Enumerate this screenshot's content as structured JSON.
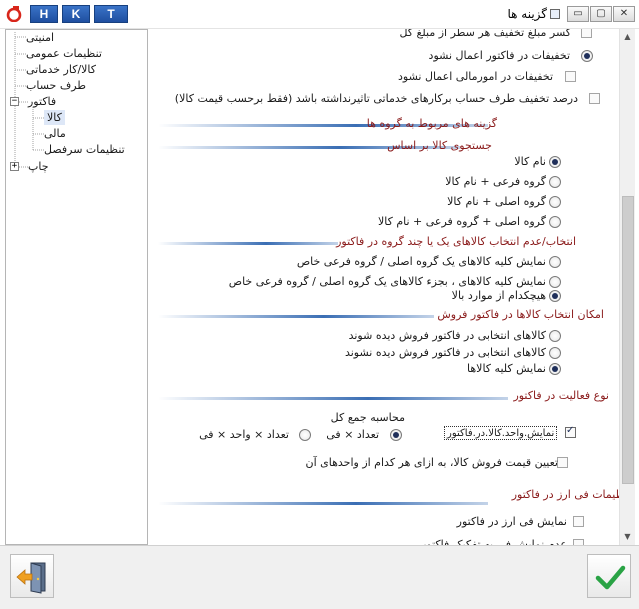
{
  "window": {
    "title": "گزینه ها",
    "lang_buttons": [
      "H",
      "K",
      "T"
    ],
    "controls": {
      "minimize": "▭",
      "maximize": "▢",
      "close": "✕"
    }
  },
  "tree": {
    "items": [
      {
        "label": "امنیتی"
      },
      {
        "label": "تنظیمات عمومی"
      },
      {
        "label": "کالا/کار خدماتی"
      },
      {
        "label": "طرف حساب"
      },
      {
        "label": "فاکتور",
        "expander": "−"
      },
      {
        "label": "کالا",
        "selected": true
      },
      {
        "label": "مالی"
      },
      {
        "label": "تنظیمات سرفصل"
      },
      {
        "label": "چاپ",
        "expander": "+"
      }
    ]
  },
  "settings": {
    "discount": {
      "cut_line_discount": "کسر مبلغ تخفیف هر سطر از مبلغ کل",
      "no_invoice_discount": "تخفیفات در فاکتور اعمال نشود",
      "no_finance_discount": "تخفیفات در امورمالی اعمال نشود",
      "party_discount_pct": "درصد تخفیف طرف حساب برکارهای خدماتی تاثیرنداشته باشد (فقط برحسب قیمت کالا)"
    },
    "group_options_header": "گزینه های مربوط به گروه ها",
    "search": {
      "header": "جستجوی کالا بر اساس",
      "options": [
        "نام کالا",
        "گروه فرعی + نام کالا",
        "گروه اصلی + نام کالا",
        "گروه اصلی + گروه فرعی + نام کالا"
      ]
    },
    "select_groups": {
      "header": "انتخاب/عدم انتخاب کالاهای یک یا چند گروه در فاکتور",
      "options": [
        "نمایش کلیه کالاهای یک گروه اصلی / گروه فرعی خاص",
        "نمایش کلیه کالاهای ، بجزء کالاهای یک گروه اصلی / گروه فرعی خاص",
        "هیچکدام از موارد بالا"
      ]
    },
    "sales_selection": {
      "header": "امکان انتخاب کالاها در فاکتور فروش",
      "options": [
        "کالاهای انتخابی در فاکتور فروش دیده شوند",
        "کالاهای انتخابی در فاکتور فروش دیده نشوند",
        "نمایش کلیه کالاها"
      ]
    },
    "activity": {
      "header": "نوع فعالیت در فاکتور",
      "calc_total_label": "محاسبه جمع کل",
      "show_unit_field": "نمایش.واحد.کالا.در.فاکتور",
      "opt_qty_price": "تعداد × فی",
      "opt_qty_unit_price": "تعداد × واحد × فی",
      "unit_price_each": "تعیین قیمت فروش کالا، به ازای هر کدام از واحدهای آن"
    },
    "currency": {
      "header": "تنظیمات فی ارز در فاکتور",
      "show_currency_price": "نمایش فی ارز در فاکتور",
      "cut_off": "عدم نمایش فی به تفکیک فاکتور"
    }
  },
  "colors": {
    "section_header": "#8a1a1a",
    "rule": "#3a6eb4",
    "ok_check": "#2aa345",
    "exit_arrow": "#f0a020"
  },
  "icons": {
    "exit": "exit-door-icon",
    "ok": "checkmark-icon"
  }
}
